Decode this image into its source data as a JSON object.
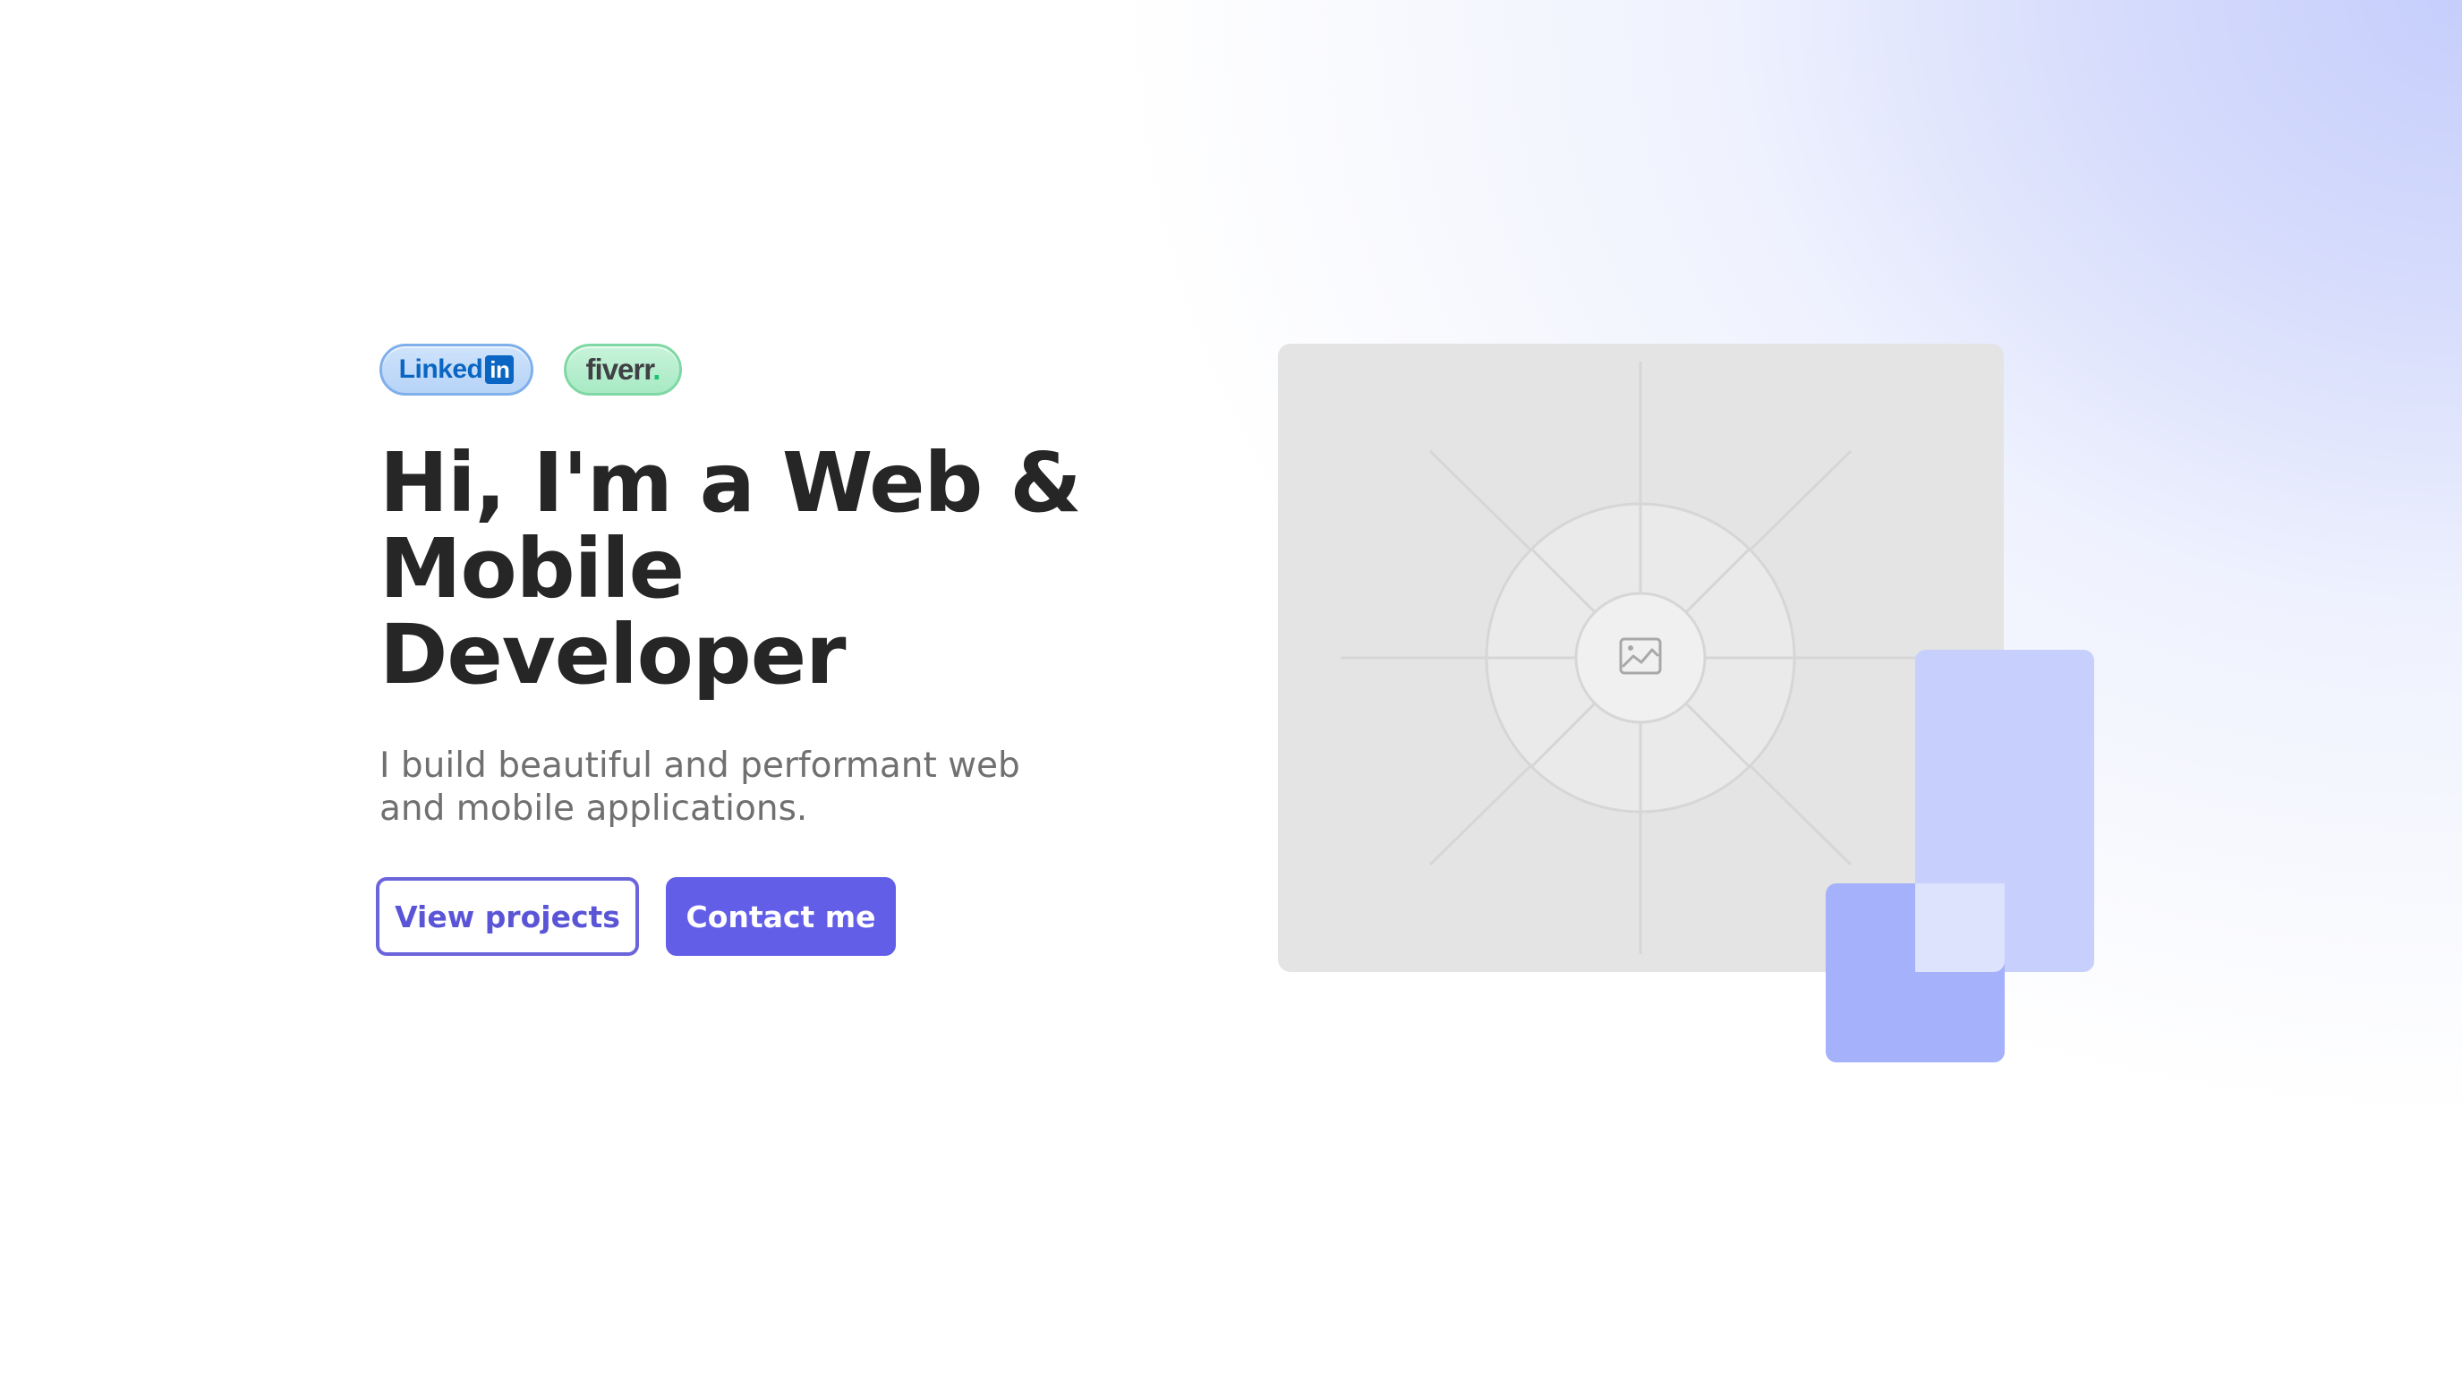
{
  "badges": {
    "linkedin": {
      "label": "Linked",
      "box": "in"
    },
    "fiverr": {
      "label": "fiverr",
      "dot": "."
    }
  },
  "hero": {
    "headline": "Hi, I'm a Web &\nMobile\nDeveloper",
    "subtitle": "I build beautiful and performant web\nand mobile applications."
  },
  "cta": {
    "view_projects": "View projects",
    "contact_me": "Contact me"
  },
  "illustration": {
    "placeholder_icon": "image-icon"
  },
  "colors": {
    "accent": "#625ee8",
    "headline": "#262626",
    "subtitle": "#707070",
    "linkedin_blue": "#0a66c2",
    "fiverr_green": "#1dbf73",
    "deco_light": "#c7cffc",
    "deco_mid": "#a5b1fa",
    "placeholder_bg": "#e4e4e4"
  }
}
